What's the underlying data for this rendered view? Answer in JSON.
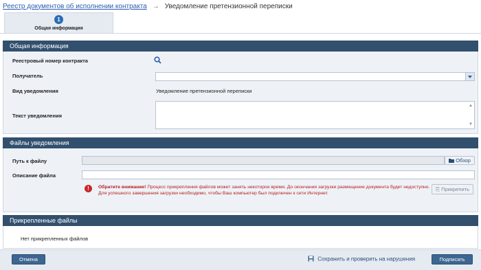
{
  "breadcrumb": {
    "parent": "Реестр документов об исполнении контракта",
    "current": "Уведомление претензионной переписки"
  },
  "steps": [
    {
      "number": "1",
      "label": "Общая информация"
    }
  ],
  "general": {
    "header": "Общая информация",
    "registry_label": "Реестровый номер контракта",
    "recipient_label": "Получатель",
    "recipient_value": "",
    "notice_type_label": "Вид уведомления",
    "notice_type_value": "Уведомление претензионной переписки",
    "notice_text_label": "Текст уведомления",
    "notice_text_value": ""
  },
  "files": {
    "header": "Файлы уведомления",
    "path_label": "Путь к файлу",
    "path_value": "",
    "browse_label": "Обзор",
    "desc_label": "Описание файла",
    "desc_value": "",
    "warning_strong": "Обратите внимание!",
    "warning_line1": " Процесс прикрепления файлов может занять некоторое время. До окончания загрузки размещение документа будет недоступно.",
    "warning_line2": "Для успешного завершения загрузки необходимо, чтобы Ваш компьютер был подключен к сети Интернет.",
    "attach_label": "Прикрепить"
  },
  "attached": {
    "header": "Прикрепленные файлы",
    "empty_text": "Нет прикрепленных файлов"
  },
  "footer": {
    "cancel_label": "Отмена",
    "save_check_label": "Сохранить и проверить на нарушения",
    "sign_label": "Подписать"
  },
  "colors": {
    "section_header": "#32506e",
    "link": "#2a5db0",
    "warning": "#b71c1c",
    "primary_button": "#3d6690"
  },
  "icons": {
    "search": "search-icon",
    "dropdown": "chevron-down-icon",
    "folder": "folder-icon",
    "warning": "warning-icon",
    "attach": "paperclip-icon",
    "save": "save-icon"
  }
}
